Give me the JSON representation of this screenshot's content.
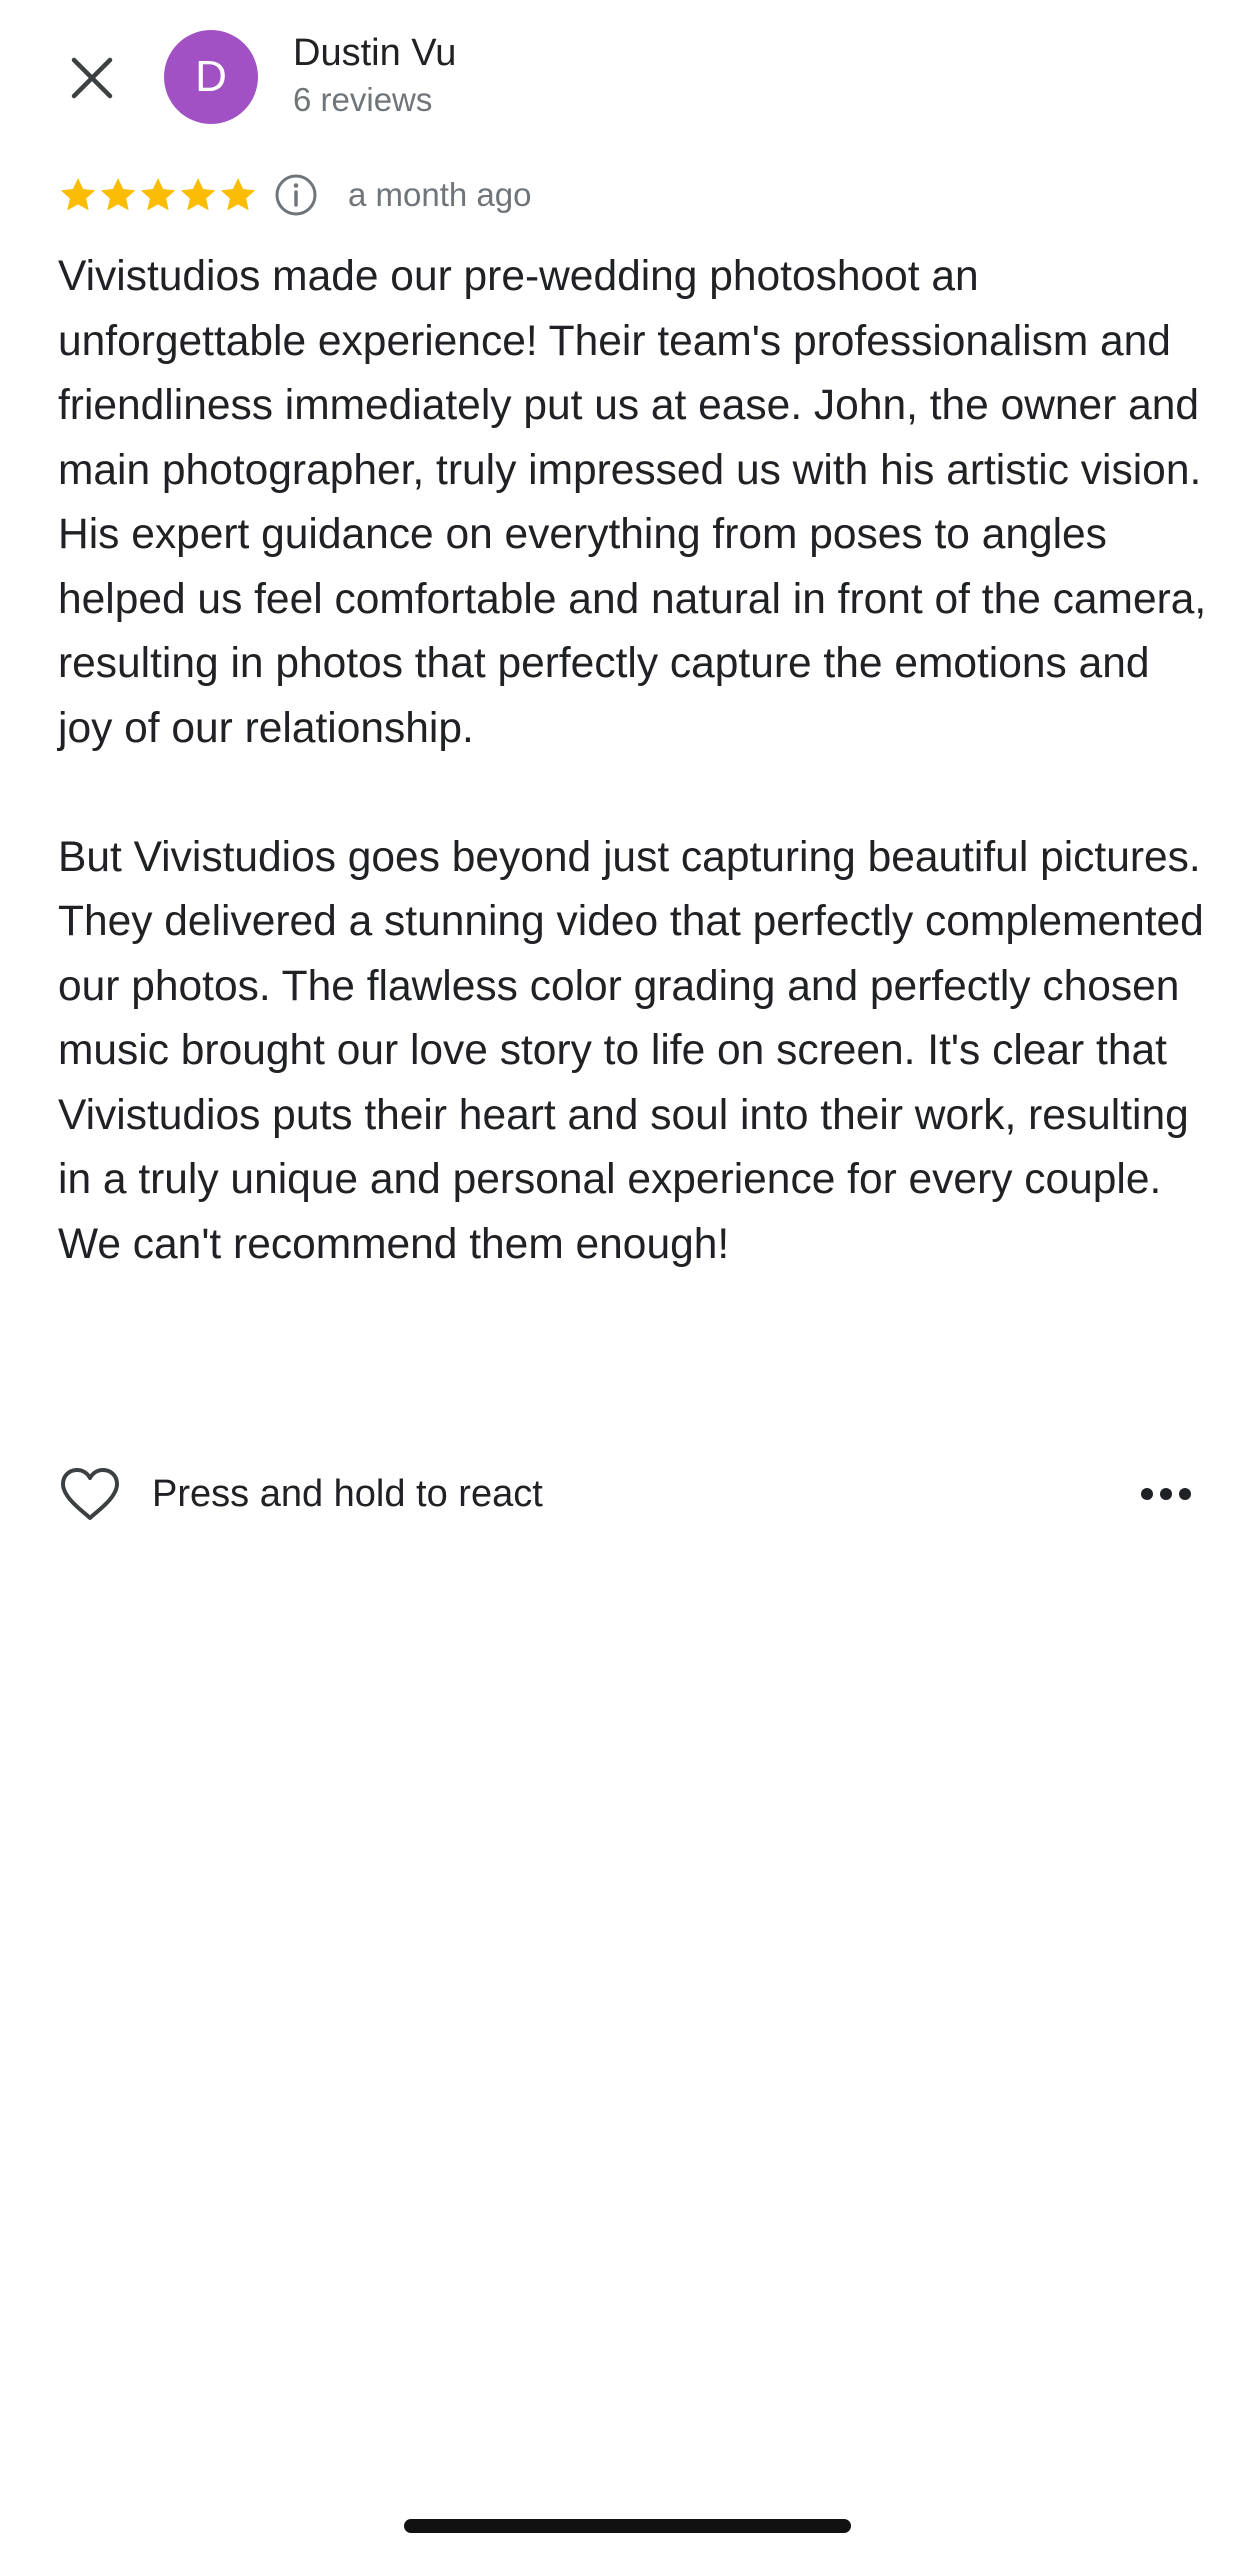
{
  "header": {
    "close_icon": "close-icon",
    "avatar_letter": "D",
    "avatar_color": "#a251c4",
    "name": "Dustin Vu",
    "review_count": "6 reviews"
  },
  "rating": {
    "stars": 5,
    "star_color": "#fbbc04",
    "info_icon": "info-icon",
    "time_ago": "a month ago"
  },
  "review": {
    "paragraph_1": "Vivistudios made our pre-wedding photoshoot an unforgettable experience! Their team's professionalism and friendliness immediately put us at ease. John, the owner and main photographer, truly impressed us with his artistic vision.  His expert guidance on everything from poses to angles helped us feel comfortable and natural in front of the camera, resulting in photos that perfectly capture the emotions and joy of our relationship.",
    "paragraph_2": "But Vivistudios goes beyond just capturing beautiful pictures.  They delivered a stunning video that perfectly complemented our photos. The flawless color grading and perfectly chosen music brought our love story to life on screen. It's clear that Vivistudios puts their heart and soul into their work, resulting in a truly unique and personal experience for every couple. We can't recommend them enough!"
  },
  "actions": {
    "heart_icon": "heart-icon",
    "react_label": "Press and hold to react",
    "more_icon": "more-horizontal-icon"
  }
}
